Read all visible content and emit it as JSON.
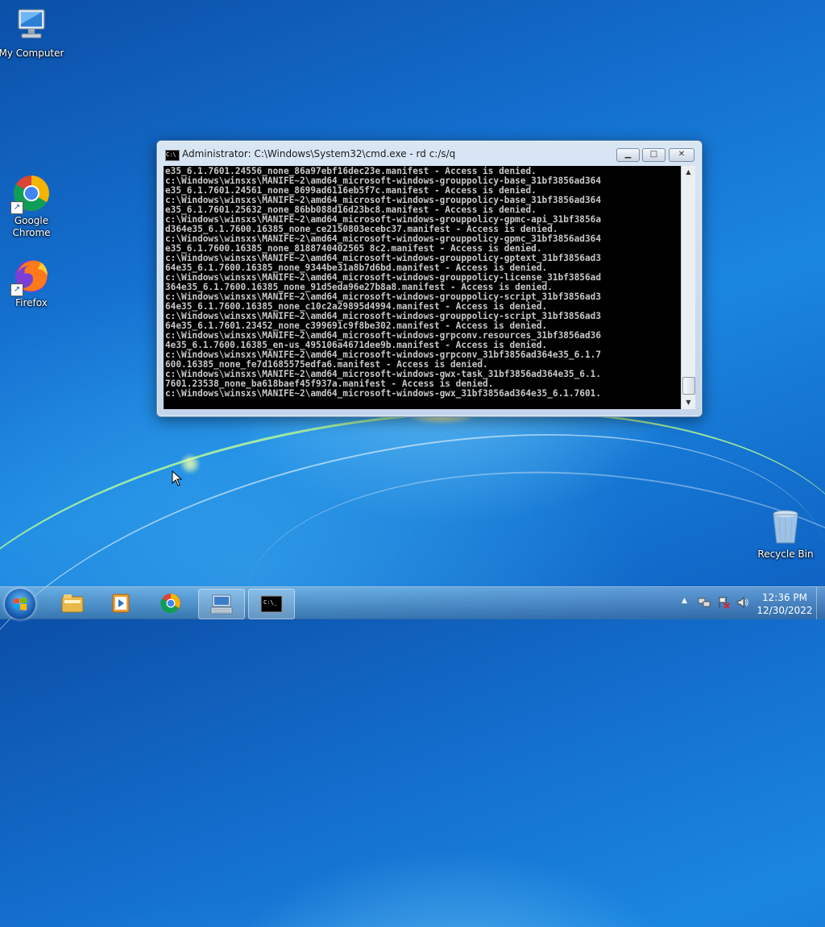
{
  "desktop": {
    "icons": [
      {
        "label": "My Computer"
      },
      {
        "label": "Google Chrome"
      },
      {
        "label": "Firefox"
      },
      {
        "label": "Recycle Bin"
      }
    ]
  },
  "window": {
    "title": "Administrator: C:\\Windows\\System32\\cmd.exe - rd  c:/s/q",
    "minimize_glyph": "▁",
    "maximize_glyph": "□",
    "close_glyph": "✕",
    "console_lines": [
      "e35_6.1.7601.24556_none_86a97ebf16dec23e.manifest - Access is denied.",
      "c:\\Windows\\winsxs\\MANIFE~2\\amd64_microsoft-windows-grouppolicy-base_31bf3856ad364",
      "e35_6.1.7601.24561_none_8699ad6116eb5f7c.manifest - Access is denied.",
      "c:\\Windows\\winsxs\\MANIFE~2\\amd64_microsoft-windows-grouppolicy-base_31bf3856ad364",
      "e35_6.1.7601.25632_none_86bb088d16d23bc8.manifest - Access is denied.",
      "c:\\Windows\\winsxs\\MANIFE~2\\amd64_microsoft-windows-grouppolicy-gpmc-api_31bf3856a",
      "d364e35_6.1.7600.16385_none_ce2150803ecebc37.manifest - Access is denied.",
      "c:\\Windows\\winsxs\\MANIFE~2\\amd64_microsoft-windows-grouppolicy-gpmc_31bf3856ad364",
      "e35_6.1.7600.16385_none_8188740402565 8c2.manifest - Access is denied.",
      "c:\\Windows\\winsxs\\MANIFE~2\\amd64_microsoft-windows-grouppolicy-gptext_31bf3856ad3",
      "64e35_6.1.7600.16385_none_9344be31a8b7d6bd.manifest - Access is denied.",
      "c:\\Windows\\winsxs\\MANIFE~2\\amd64_microsoft-windows-grouppolicy-license_31bf3856ad",
      "364e35_6.1.7600.16385_none_91d5eda96e27b8a8.manifest - Access is denied.",
      "c:\\Windows\\winsxs\\MANIFE~2\\amd64_microsoft-windows-grouppolicy-script_31bf3856ad3",
      "64e35_6.1.7600.16385_none_c10c2a29895d4994.manifest - Access is denied.",
      "c:\\Windows\\winsxs\\MANIFE~2\\amd64_microsoft-windows-grouppolicy-script_31bf3856ad3",
      "64e35_6.1.7601.23452_none_c399691c9f8be302.manifest - Access is denied.",
      "c:\\Windows\\winsxs\\MANIFE~2\\amd64_microsoft-windows-grpconv.resources_31bf3856ad36",
      "4e35_6.1.7600.16385_en-us_495106a4671dee9b.manifest - Access is denied.",
      "c:\\Windows\\winsxs\\MANIFE~2\\amd64_microsoft-windows-grpconv_31bf3856ad364e35_6.1.7",
      "600.16385_none_fe7d1685575edfa6.manifest - Access is denied.",
      "c:\\Windows\\winsxs\\MANIFE~2\\amd64_microsoft-windows-gwx-task_31bf3856ad364e35_6.1.",
      "7601.23538_none_ba618baef45f937a.manifest - Access is denied.",
      "c:\\Windows\\winsxs\\MANIFE~2\\amd64_microsoft-windows-gwx_31bf3856ad364e35_6.1.7601."
    ]
  },
  "taskbar": {
    "clock_time": "12:36 PM",
    "clock_date": "12/30/2022",
    "tray_chevron": "▲"
  },
  "colors": {
    "console_bg": "#000000",
    "console_fg": "#c8c8c8",
    "desktop_blue": "#1470cf"
  }
}
